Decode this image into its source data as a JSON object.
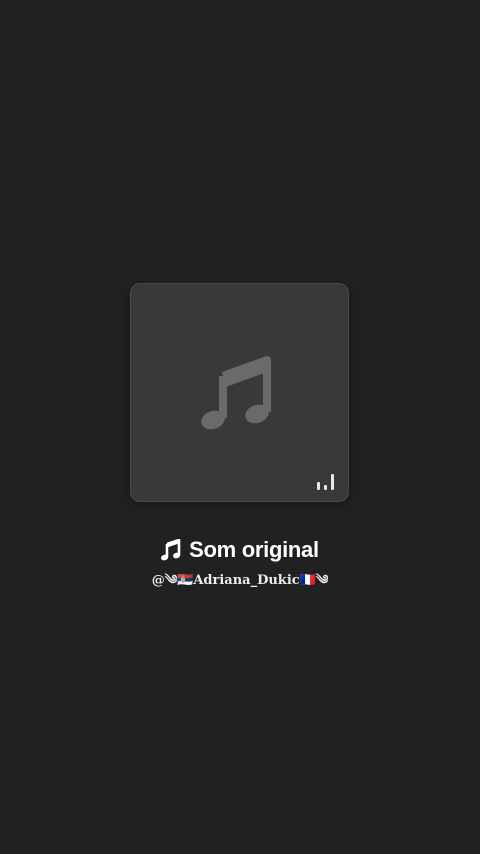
{
  "sound": {
    "title": "Som original",
    "author": "@༄🇷🇸𝐀𝐝𝐫𝐢𝐚𝐧𝐚_𝐃𝐮𝐤𝐢𝐜🇫🇷༄"
  },
  "icons": {
    "cover": "music-note-icon",
    "playing": "audio-bars-icon",
    "title": "music-note-icon"
  },
  "colors": {
    "background": "#222122",
    "cover": "#3a393a",
    "note": "#6b6a6b",
    "text": "#ffffff"
  }
}
